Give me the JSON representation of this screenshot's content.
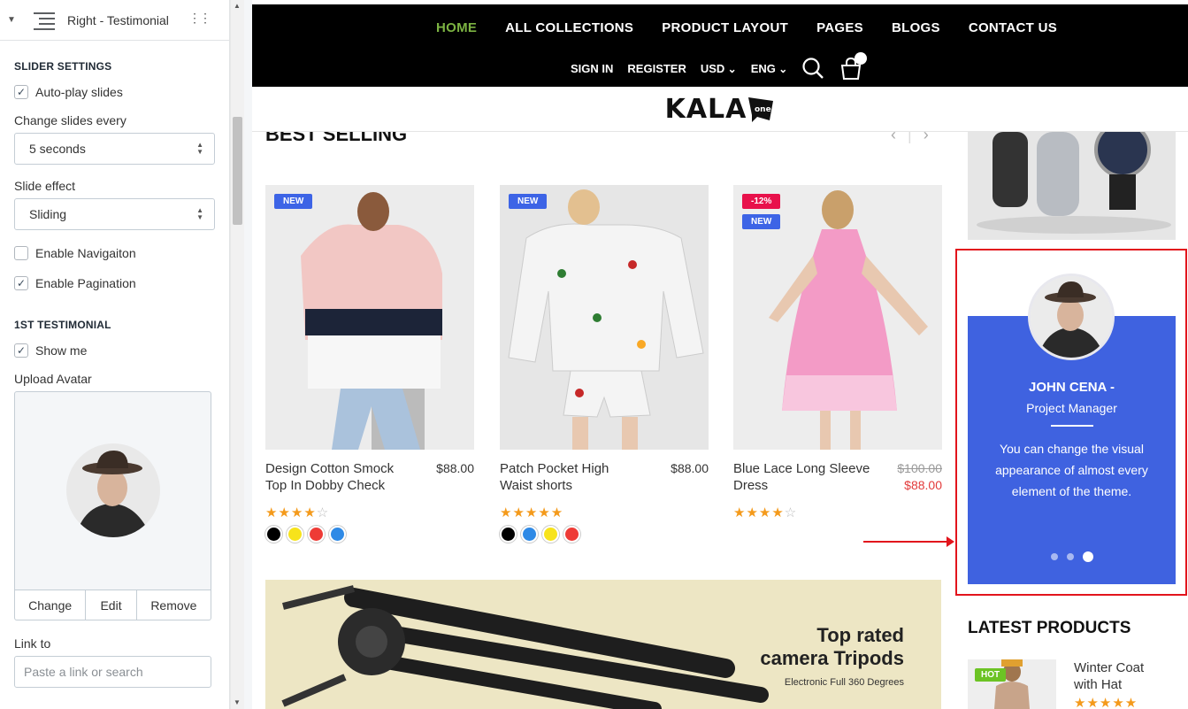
{
  "panel": {
    "header_title": "Right - Testimonial",
    "slider_settings_title": "SLIDER SETTINGS",
    "autoplay_label": "Auto-play slides",
    "change_slides_label": "Change slides every",
    "change_slides_value": "5 seconds",
    "slide_effect_label": "Slide effect",
    "slide_effect_value": "Sliding",
    "enable_navigation_label": "Enable Navigaiton",
    "enable_pagination_label": "Enable Pagination",
    "first_testimonial_title": "1ST TESTIMONIAL",
    "show_me_label": "Show me",
    "upload_avatar_label": "Upload Avatar",
    "change_button": "Change",
    "edit_button": "Edit",
    "remove_button": "Remove",
    "link_to_label": "Link to",
    "link_placeholder": "Paste a link or search",
    "checkbox_states": {
      "autoplay": true,
      "navigation": false,
      "pagination": true,
      "show_me": true
    }
  },
  "store": {
    "nav_main": [
      "HOME",
      "ALL COLLECTIONS",
      "PRODUCT LAYOUT",
      "PAGES",
      "BLOGS",
      "CONTACT US"
    ],
    "nav_active": "HOME",
    "nav_secondary": {
      "sign_in": "SIGN IN",
      "register": "REGISTER",
      "currency": "USD",
      "language": "ENG"
    },
    "cart_count": "0",
    "logo": "KALA",
    "best_selling_title": "BEST SELLING",
    "products": [
      {
        "badges": [
          "NEW"
        ],
        "name": "Design Cotton Smock Top In Dobby Check",
        "price": "$88.00",
        "old_price": "",
        "rating": 4,
        "colors": [
          "#000000",
          "#f7e31b",
          "#ee3b36",
          "#2f8ae6"
        ]
      },
      {
        "badges": [
          "NEW"
        ],
        "name": "Patch Pocket High Waist shorts",
        "price": "$88.00",
        "old_price": "",
        "rating": 5,
        "colors": [
          "#000000",
          "#2f8ae6",
          "#f7e31b",
          "#ee3b36"
        ]
      },
      {
        "badges": [
          "-12%",
          "NEW"
        ],
        "name": "Blue Lace Long Sleeve Dress",
        "price": "$88.00",
        "old_price": "$100.00",
        "rating": 4,
        "colors": []
      }
    ],
    "banner": {
      "title_line1": "Top rated",
      "title_line2": "camera Tripods",
      "subtitle": "Electronic Full 360 Degrees"
    },
    "testimonial": {
      "name": "JOHN CENA  -",
      "role": "Project Manager",
      "quote": "You can change the visual appearance of almost every element of the theme.",
      "dots": 3,
      "active_dot": 3
    },
    "latest_products_title": "LATEST PRODUCTS",
    "latest_product": {
      "badge": "HOT",
      "name": "Winter Coat with Hat"
    }
  },
  "colors": {
    "accent_green": "#7cb342",
    "testimonial_blue": "#3f62e0",
    "highlight_red": "#e2141c",
    "badge_new": "#3d64e6",
    "badge_sale": "#e8114b",
    "star": "#f49a1b"
  }
}
